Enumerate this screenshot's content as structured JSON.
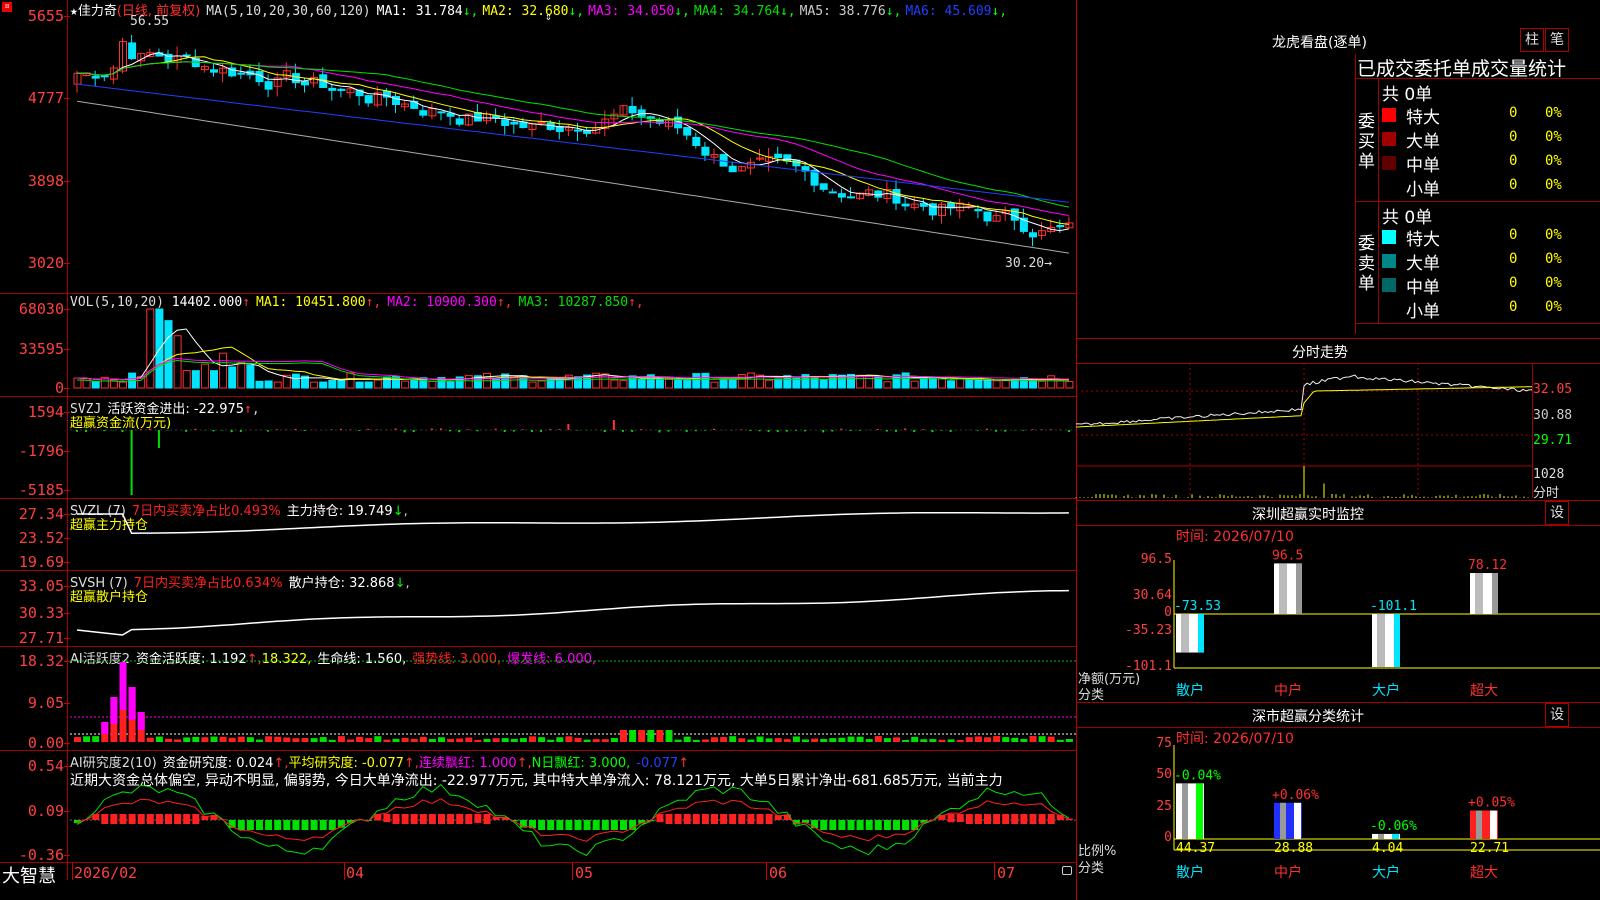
{
  "header": {
    "star": "★",
    "name": "佳力奇",
    "period": "(日线, 前复权)",
    "ma_params": "MA(5,10,20,30,60,120)",
    "ma": [
      {
        "label": "MA1: 31.784",
        "arrow": "↓",
        "color": "#ffffff"
      },
      {
        "label": "MA2: 32.680",
        "arrow": "↓",
        "color": "#ffff00"
      },
      {
        "label": "MA3: 34.050",
        "arrow": "↓",
        "color": "#ff00ff"
      },
      {
        "label": "MA4: 34.764",
        "arrow": "↓",
        "color": "#00e000"
      },
      {
        "label": "MA5: 38.776",
        "arrow": "↓",
        "color": "#cccccc"
      },
      {
        "label": "MA6: 45.609",
        "arrow": "↓",
        "color": "#2040ff"
      }
    ],
    "high_label": "56.55",
    "low_label": "30.20"
  },
  "price_axis": [
    "5655",
    "4777",
    "3898",
    "3020"
  ],
  "vol": {
    "title": "VOL(5,10,20)",
    "value": "14402.000",
    "arrow": "↑",
    "ma": [
      {
        "label": "MA1: 10451.800",
        "color": "#ffff00"
      },
      {
        "label": "MA2: 10900.300",
        "color": "#ff00ff"
      },
      {
        "label": "MA3: 10287.850",
        "color": "#00e000"
      }
    ],
    "axis": [
      "68030",
      "33595",
      "0"
    ]
  },
  "svzj": {
    "title": "SVZJ",
    "label": "活跃资金进出: -22.975",
    "arrow": "↑",
    "sub": "超赢资金流(万元)",
    "axis": [
      "1594",
      "-1796",
      "-5185"
    ]
  },
  "svzl": {
    "title": "SVZL (7)",
    "label1": "7日内买卖净占比0.493%",
    "label2": "主力持仓: 19.749",
    "arrow": "↓",
    "sub": "超赢主力持仓",
    "axis": [
      "27.34",
      "23.52",
      "19.69"
    ]
  },
  "svsh": {
    "title": "SVSH (7)",
    "label1": "7日内买卖净占比0.634%",
    "label2": "散户持仓: 32.868",
    "arrow": "↓",
    "sub": "超赢散户持仓",
    "axis": [
      "33.05",
      "30.33",
      "27.71"
    ]
  },
  "ai1": {
    "title": "AI活跃度2",
    "label1": "资金活跃度: 1.192",
    "v2": "18.322",
    "label3": "生命线: 1.560",
    "label4": "强势线: 3.000",
    "label5": "爆发线: 6.000",
    "axis": [
      "18.32",
      "9.05",
      "0.00"
    ]
  },
  "ai2": {
    "title": "AI研究度2(10)",
    "label1": "资金研究度: 0.024",
    "label2": "平均研究度: -0.077",
    "label3": "连续飘红: 1.000",
    "label4": "N日飘红: 3.000",
    "label5": "-0.077",
    "axis": [
      "0.54",
      "0.09",
      "-0.36"
    ],
    "summary": "近期大资金总体偏空, 异动不明显, 偏弱势, 今日大单净流出: -22.977万元, 其中特大单净流入: 78.121万元, 大单5日累计净出-681.685万元, 当前主力"
  },
  "bottom": {
    "brand": "大智慧",
    "dates": [
      "2026/02",
      "04",
      "05",
      "06",
      "07"
    ]
  },
  "right": {
    "lhb_title": "龙虎看盘(逐单)",
    "btn1": "柱",
    "btn2": "笔",
    "stat_title": "已成交委托单成交量统计",
    "buy": {
      "side": "委买单",
      "total": "共 0单",
      "rows": [
        {
          "name": "特大",
          "n": "0",
          "p": "0%",
          "color": "#ff0000"
        },
        {
          "name": "大单",
          "n": "0",
          "p": "0%",
          "color": "#a00000"
        },
        {
          "name": "中单",
          "n": "0",
          "p": "0%",
          "color": "#600000"
        },
        {
          "name": "小单",
          "n": "0",
          "p": "0%",
          "color": ""
        }
      ]
    },
    "sell": {
      "side": "委卖单",
      "total": "共 0单",
      "rows": [
        {
          "name": "特大",
          "n": "0",
          "p": "0%",
          "color": "#00ffff"
        },
        {
          "name": "大单",
          "n": "0",
          "p": "0%",
          "color": "#008888"
        },
        {
          "name": "中单",
          "n": "0",
          "p": "0%",
          "color": "#006666"
        },
        {
          "name": "小单",
          "n": "0",
          "p": "0%",
          "color": ""
        }
      ]
    },
    "fs_title": "分时走势",
    "fs_axis": [
      "32.05",
      "30.88",
      "29.71"
    ],
    "fs_vol": "1028",
    "fs_unit": "分时",
    "sz_title": "深圳超赢实时监控",
    "sz_set": "设",
    "sz_time": "时间: 2026/07/10",
    "sz_axis": [
      "96.5",
      "30.64",
      "0",
      "-35.23",
      "-101.1"
    ],
    "sz_ylabel": "净额(万元)",
    "sz_xlabel": "分类",
    "sz_bars": [
      {
        "cat": "散户",
        "value": -73.53,
        "label": "-73.53"
      },
      {
        "cat": "中户",
        "value": 96.5,
        "label": "96.5"
      },
      {
        "cat": "大户",
        "value": -101.1,
        "label": "-101.1"
      },
      {
        "cat": "超大",
        "value": 78.12,
        "label": "78.12"
      }
    ],
    "fl_title": "深市超赢分类统计",
    "fl_set": "设",
    "fl_time": "时间: 2026/07/10",
    "fl_axis": [
      "75",
      "50",
      "25",
      "0"
    ],
    "fl_ylabel": "比例%",
    "fl_xlabel": "分类",
    "fl_bars": [
      {
        "cat": "散户",
        "value": 44.37,
        "label": "44.37",
        "chg": "-0.04%"
      },
      {
        "cat": "中户",
        "value": 28.88,
        "label": "28.88",
        "chg": "+0.06%"
      },
      {
        "cat": "大户",
        "value": 4.04,
        "label": "4.04",
        "chg": "-0.06%"
      },
      {
        "cat": "超大",
        "value": 22.71,
        "label": "22.71",
        "chg": "+0.05%"
      }
    ]
  },
  "chart_data": [
    {
      "type": "bar",
      "title": "深圳超赢实时监控",
      "categories": [
        "散户",
        "中户",
        "大户",
        "超大"
      ],
      "values": [
        -73.53,
        96.5,
        -101.1,
        78.12
      ],
      "ylabel": "净额(万元)",
      "xlabel": "分类",
      "ylim": [
        -101.1,
        96.5
      ]
    },
    {
      "type": "bar",
      "title": "深市超赢分类统计",
      "categories": [
        "散户",
        "中户",
        "大户",
        "超大"
      ],
      "values": [
        44.37,
        28.88,
        4.04,
        22.71
      ],
      "ylabel": "比例%",
      "xlabel": "分类",
      "ylim": [
        0,
        75
      ]
    }
  ]
}
